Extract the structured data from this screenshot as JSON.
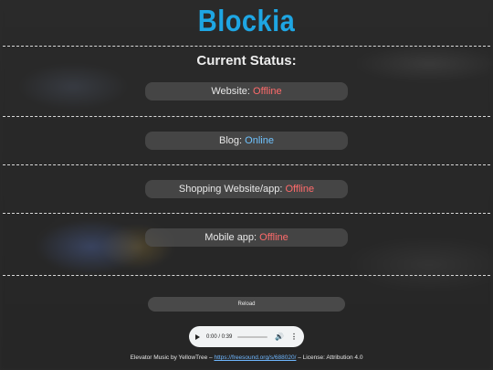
{
  "app": {
    "title": "Blockia"
  },
  "status": {
    "heading": "Current Status:",
    "items": [
      {
        "label": "Website:",
        "state": "Offline"
      },
      {
        "label": "Blog:",
        "state": "Online"
      },
      {
        "label": "Shopping Website/app:",
        "state": "Offline"
      },
      {
        "label": "Mobile app:",
        "state": "Offline"
      }
    ]
  },
  "controls": {
    "reload_label": "Reload"
  },
  "audio": {
    "time": "0:00 / 0:39",
    "progress": 0
  },
  "footer": {
    "prefix": "Elevator Music by YellowTree – ",
    "link_text": "https://freesound.org/s/688020/",
    "suffix": " – License: Attribution 4.0"
  },
  "colors": {
    "brand": "#1ea6e3",
    "offline": "#ff6b6b",
    "online": "#6fc3ff",
    "background": "#2b2b2b"
  }
}
